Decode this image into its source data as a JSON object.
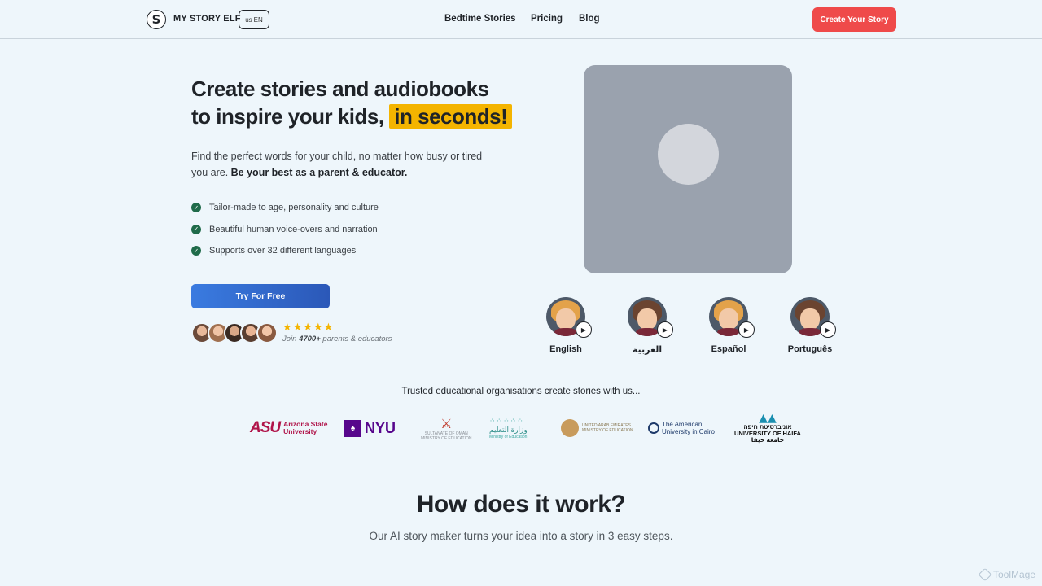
{
  "header": {
    "logo_letter": "S",
    "brand": "MY STORY ELF",
    "lang_region": "us",
    "lang_code": "EN",
    "nav": [
      "Bedtime Stories",
      "Pricing",
      "Blog"
    ],
    "cta": "Create Your Story"
  },
  "hero": {
    "title_line1": "Create stories and audiobooks",
    "title_line2": "to inspire your kids,",
    "title_highlight": "in seconds!",
    "subtitle": "Find the perfect words for your child, no matter how busy or tired you are.",
    "subtitle_bold": "Be your best as a parent & educator.",
    "features": [
      "Tailor-made to age, personality and culture",
      "Beautiful human voice-overs and narration",
      "Supports over 32 different languages"
    ],
    "try_button": "Try For Free",
    "rating_stars": "★★★★★",
    "join_prefix": "Join",
    "join_count": "4700+",
    "join_suffix": "parents & educators"
  },
  "voices": [
    {
      "label": "English",
      "hair": "#e3a24a"
    },
    {
      "label": "العربية",
      "hair": "#6b4430"
    },
    {
      "label": "Español",
      "hair": "#e3a24a"
    },
    {
      "label": "Português",
      "hair": "#6b4430"
    }
  ],
  "trusted": {
    "heading": "Trusted educational organisations create stories with us...",
    "asu_mark": "ASU",
    "asu_line1": "Arizona State",
    "asu_line2": "University",
    "nyu": "NYU",
    "oman_line1": "SULTANATE OF OMAN",
    "oman_line2": "MINISTRY OF EDUCATION",
    "saudi": "وزارة التعليم",
    "saudi_en": "Ministry of Education",
    "uae_line1": "UNITED ARAB EMIRATES",
    "uae_line2": "MINISTRY OF EDUCATION",
    "auc_line1": "The American",
    "auc_line2": "University in Cairo",
    "haifa_line1": "אוניברסיטת חיפה",
    "haifa_line2": "UNIVERSITY OF HAIFA",
    "haifa_line3": "جامعة حيفا"
  },
  "how": {
    "title": "How does it work?",
    "subtitle": "Our AI story maker turns your idea into a story in 3 easy steps."
  },
  "watermark": "ToolMage",
  "colors": {
    "accent_red": "#ef4a4a",
    "highlight": "#f4b400",
    "button_blue": "#3a7be0",
    "background": "#eef6fb"
  }
}
